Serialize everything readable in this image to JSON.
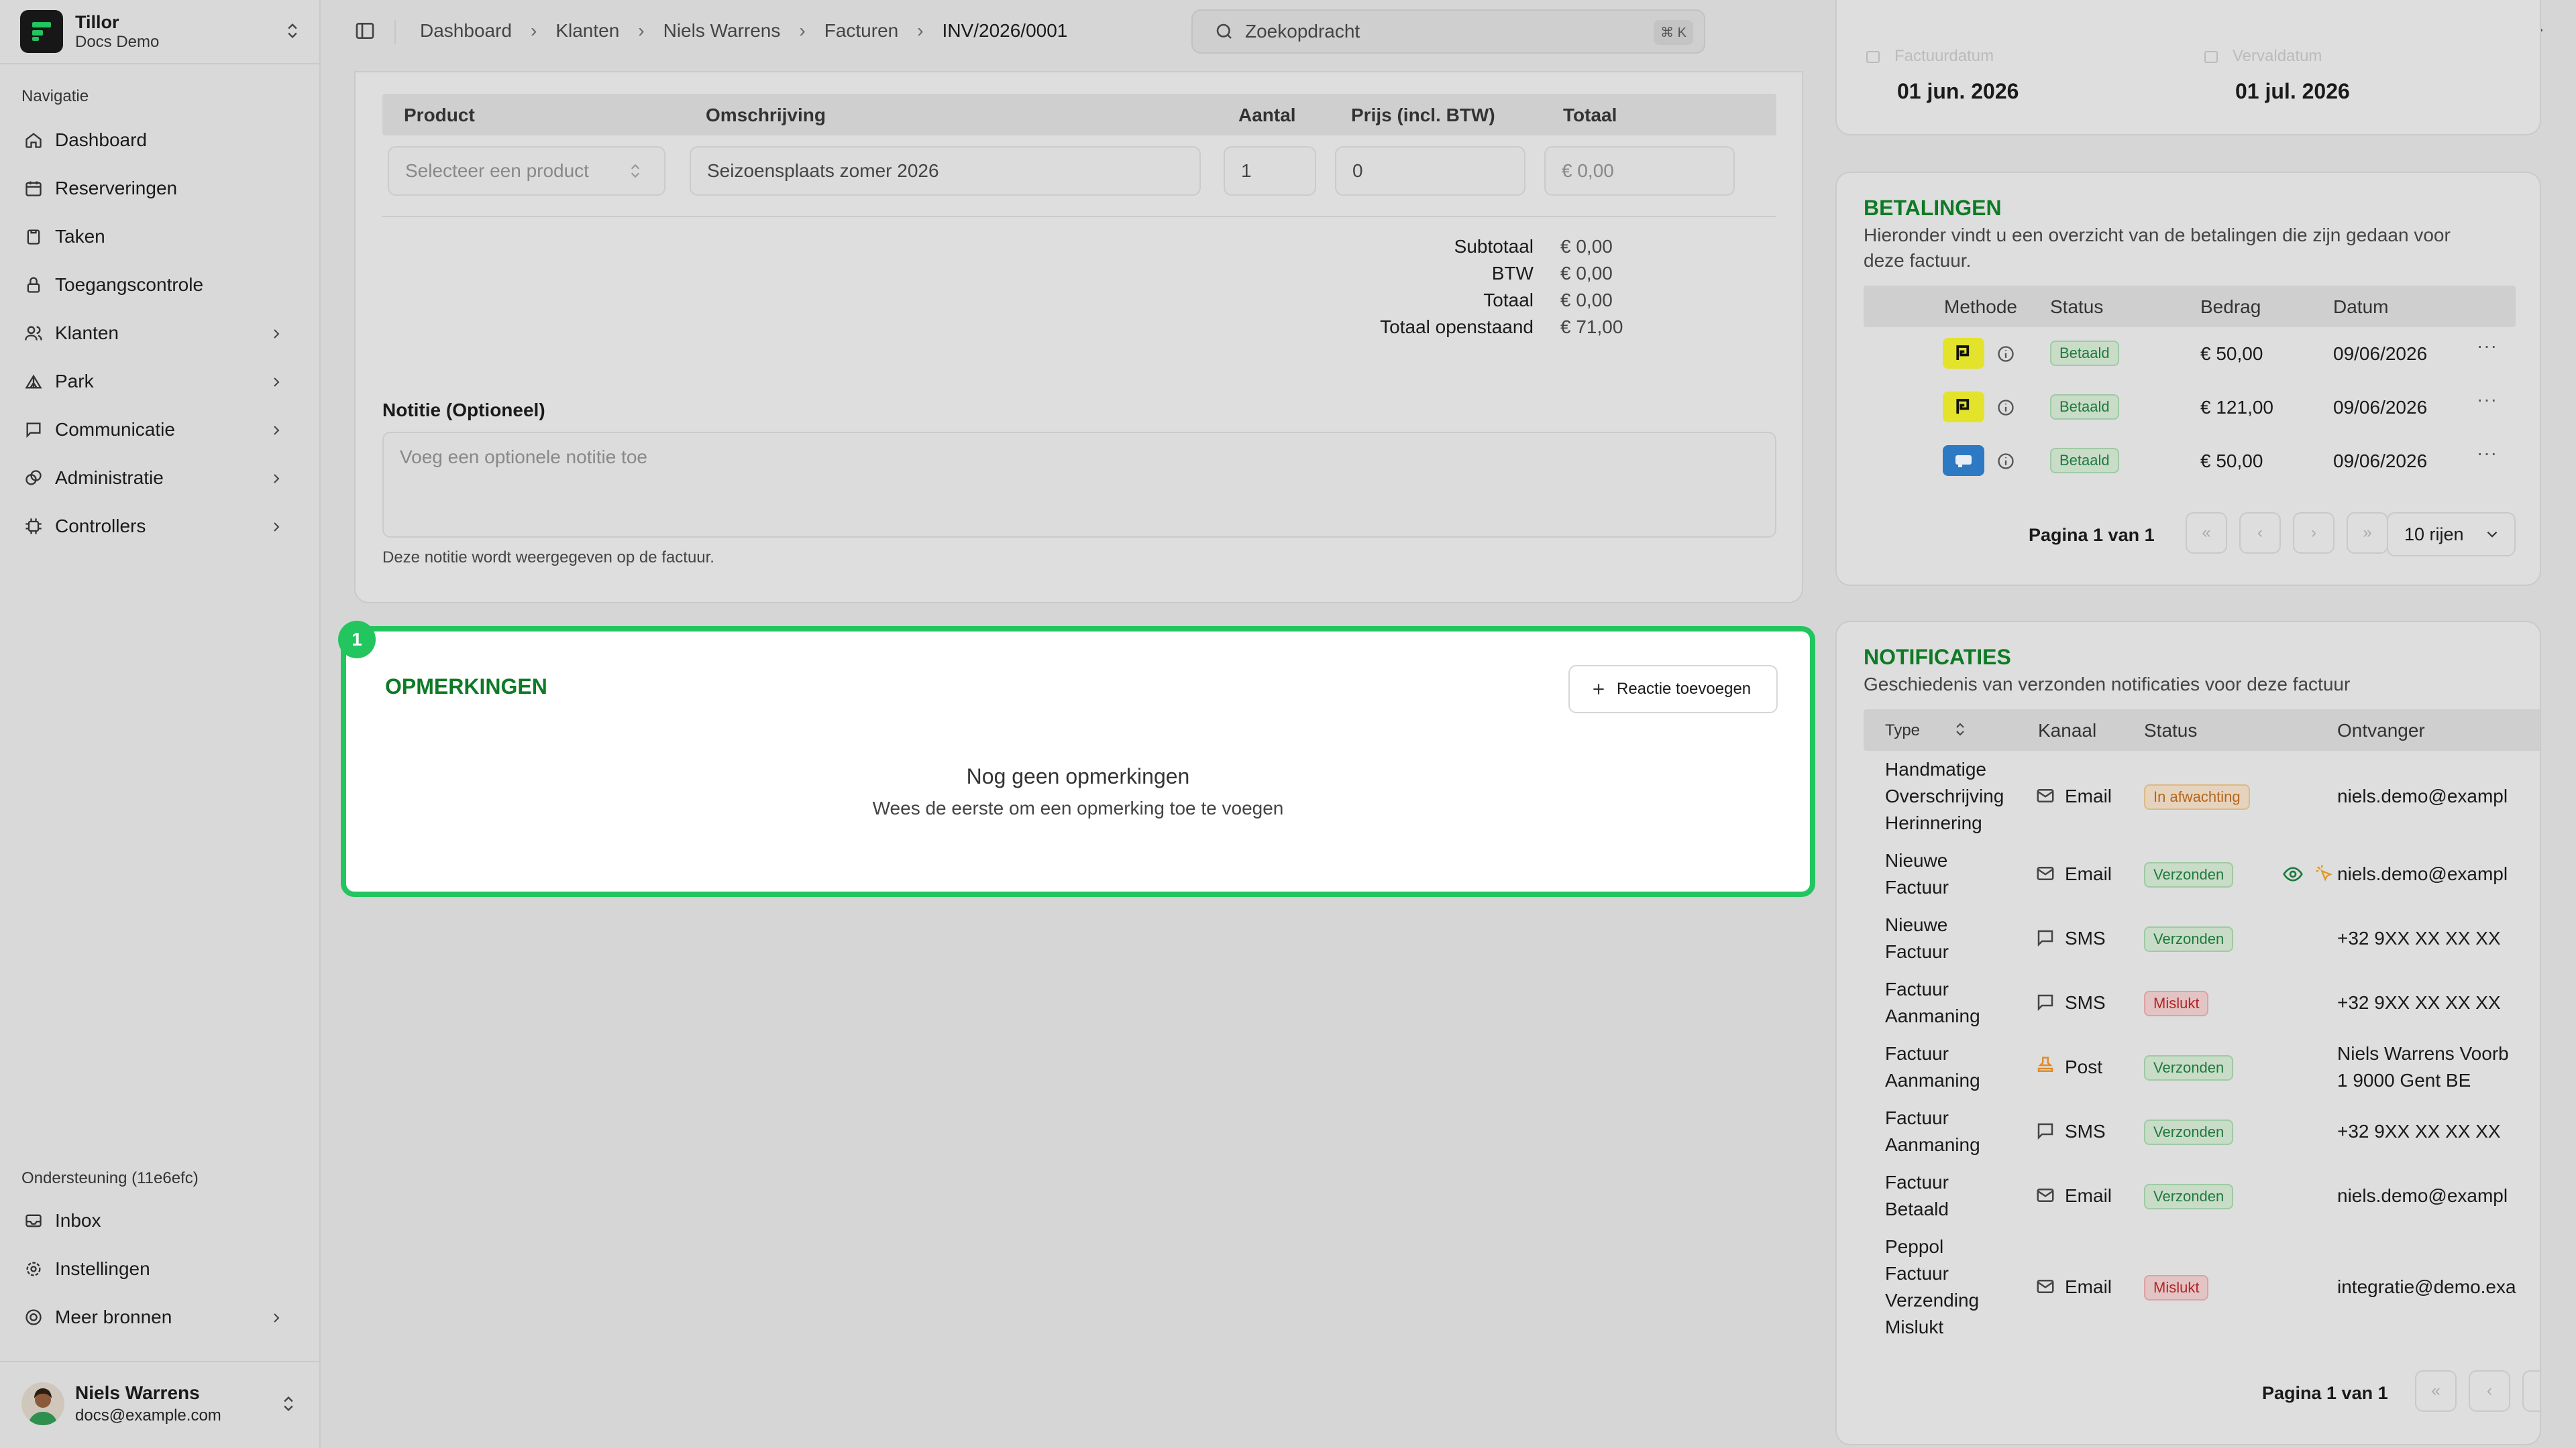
{
  "app": {
    "name": "Tillor",
    "workspace": "Docs Demo"
  },
  "sidebar": {
    "heading": "Navigatie",
    "items": [
      {
        "label": "Dashboard",
        "icon": "home-icon"
      },
      {
        "label": "Reserveringen",
        "icon": "calendar-icon"
      },
      {
        "label": "Taken",
        "icon": "clipboard-icon"
      },
      {
        "label": "Toegangscontrole",
        "icon": "lock-icon"
      },
      {
        "label": "Klanten",
        "icon": "users-icon"
      },
      {
        "label": "Park",
        "icon": "tent-icon"
      },
      {
        "label": "Communicatie",
        "icon": "message-icon"
      },
      {
        "label": "Administratie",
        "icon": "coins-icon"
      },
      {
        "label": "Controllers",
        "icon": "cpu-icon"
      }
    ],
    "support_heading": "Ondersteuning (11e6efc)",
    "support_items": [
      {
        "label": "Inbox",
        "icon": "inbox-icon"
      },
      {
        "label": "Instellingen",
        "icon": "settings-icon"
      },
      {
        "label": "Meer bronnen",
        "icon": "lifebuoy-icon"
      }
    ],
    "user": {
      "name": "Niels Warrens",
      "email": "docs@example.com"
    }
  },
  "topbar": {
    "breadcrumbs": [
      "Dashboard",
      "Klanten",
      "Niels Warrens",
      "Facturen",
      "INV/2026/0001"
    ],
    "search_placeholder": "Zoekopdracht",
    "search_shortcut": "⌘ K"
  },
  "invoice_lines": {
    "headers": [
      "Product",
      "Omschrijving",
      "Aantal",
      "Prijs (incl. BTW)",
      "Totaal"
    ],
    "product_placeholder": "Selecteer een product",
    "description": "Seizoensplaats zomer 2026",
    "quantity": "1",
    "price": "0",
    "total": "€ 0,00",
    "summary": [
      {
        "label": "Subtotaal",
        "value": "€ 0,00"
      },
      {
        "label": "BTW",
        "value": "€ 0,00"
      },
      {
        "label": "Totaal",
        "value": "€ 0,00"
      },
      {
        "label": "Totaal openstaand",
        "value": "€ 71,00"
      }
    ],
    "note_label": "Notitie (Optioneel)",
    "note_placeholder": "Voeg een optionele notitie toe",
    "note_help": "Deze notitie wordt weergegeven op de factuur."
  },
  "comments": {
    "marker": "1",
    "title": "OPMERKINGEN",
    "add_button": "Reactie toevoegen",
    "empty_title": "Nog geen opmerkingen",
    "empty_sub": "Wees de eerste om een opmerking toe te voegen"
  },
  "dates": {
    "invoice_date_label": "Factuurdatum",
    "invoice_date": "01 jun. 2026",
    "due_date_label": "Vervaldatum",
    "due_date": "01 jul. 2026"
  },
  "payments": {
    "title": "BETALINGEN",
    "subtitle_line1": "Hieronder vindt u een overzicht van de betalingen die zijn gedaan voor",
    "subtitle_line2": "deze factuur.",
    "headers": [
      "Methode",
      "Status",
      "Bedrag",
      "Datum"
    ],
    "rows": [
      {
        "method": "payconiq",
        "status": "Betaald",
        "amount": "€ 50,00",
        "date": "09/06/2026"
      },
      {
        "method": "payconiq",
        "status": "Betaald",
        "amount": "€ 121,00",
        "date": "09/06/2026"
      },
      {
        "method": "bank-card",
        "status": "Betaald",
        "amount": "€ 50,00",
        "date": "09/06/2026"
      }
    ],
    "pagination": "Pagina 1 van 1",
    "rows_select": "10 rijen"
  },
  "notifications": {
    "title": "NOTIFICATIES",
    "subtitle": "Geschiedenis van verzonden notificaties voor deze factuur",
    "headers": [
      "Type",
      "Kanaal",
      "Status",
      "Ontvanger"
    ],
    "rows": [
      {
        "type": [
          "Handmatige",
          "Overschrijving",
          "Herinnering"
        ],
        "channel": "Email",
        "status": "In afwachting",
        "recipient": "niels.demo@exampl",
        "tone": "orange"
      },
      {
        "type": [
          "Nieuwe",
          "Factuur"
        ],
        "channel": "Email",
        "status": "Verzonden",
        "recipient": "niels.demo@exampl",
        "tone": "green"
      },
      {
        "type": [
          "Nieuwe",
          "Factuur"
        ],
        "channel": "SMS",
        "status": "Verzonden",
        "recipient": "+32 9XX XX XX XX",
        "tone": "green"
      },
      {
        "type": [
          "Factuur",
          "Aanmaning"
        ],
        "channel": "SMS",
        "status": "Mislukt",
        "recipient": "+32 9XX XX XX XX",
        "tone": "red"
      },
      {
        "type": [
          "Factuur",
          "Aanmaning"
        ],
        "channel": "Post",
        "status": "Verzonden",
        "recipient": "Niels Warrens Voorb",
        "recipient2": "1 9000 Gent BE",
        "tone": "green"
      },
      {
        "type": [
          "Factuur",
          "Aanmaning"
        ],
        "channel": "SMS",
        "status": "Verzonden",
        "recipient": "+32 9XX XX XX XX",
        "tone": "green"
      },
      {
        "type": [
          "Factuur",
          "Betaald"
        ],
        "channel": "Email",
        "status": "Verzonden",
        "recipient": "niels.demo@exampl",
        "tone": "green"
      },
      {
        "type": [
          "Peppol",
          "Factuur",
          "Verzending",
          "Mislukt"
        ],
        "channel": "Email",
        "status": "Mislukt",
        "recipient": "integratie@demo.exa",
        "tone": "red"
      }
    ],
    "pagination": "Pagina 1 van 1"
  },
  "colors": {
    "accent": "#0e7a25",
    "highlight": "#22c55e"
  }
}
